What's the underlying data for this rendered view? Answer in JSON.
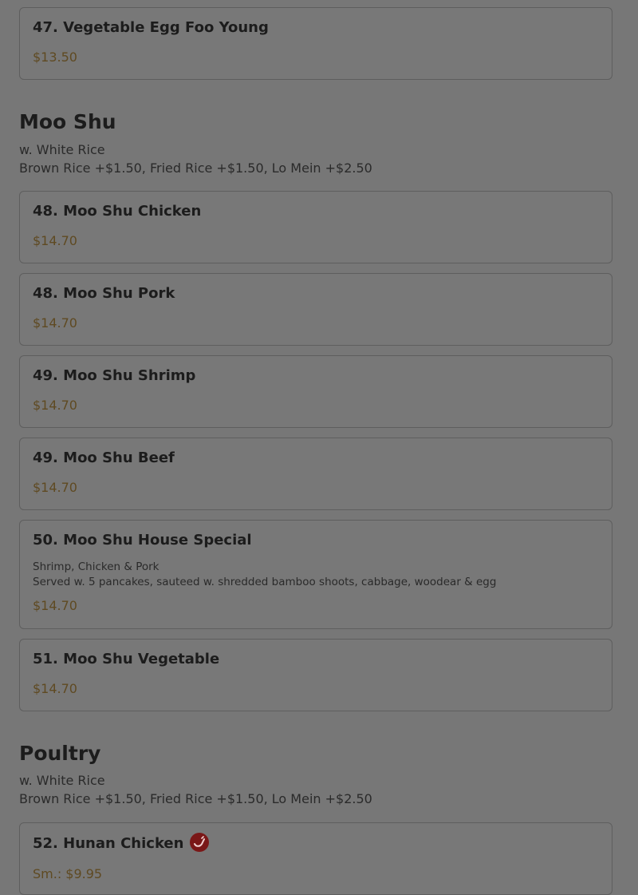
{
  "items": [
    {
      "title": "47. Vegetable Egg Foo Young",
      "price": "$13.50"
    },
    {
      "title": "48. Moo Shu Chicken",
      "price": "$14.70"
    },
    {
      "title": "48. Moo Shu Pork",
      "price": "$14.70"
    },
    {
      "title": "49. Moo Shu Shrimp",
      "price": "$14.70"
    },
    {
      "title": "49. Moo Shu Beef",
      "price": "$14.70"
    },
    {
      "title": "50. Moo Shu House Special",
      "desc1": "Shrimp, Chicken & Pork",
      "desc2": "Served w. 5 pancakes, sauteed w. shredded bamboo shoots, cabbage, woodear & egg",
      "price": "$14.70"
    },
    {
      "title": "51. Moo Shu Vegetable",
      "price": "$14.70"
    },
    {
      "title": "52. Hunan Chicken",
      "price": "Sm.: $9.95",
      "icon": "chili-pepper-icon"
    }
  ],
  "sections": [
    {
      "title": "Moo Shu",
      "note1": "w. White Rice",
      "note2": "Brown Rice +$1.50, Fried Rice +$1.50, Lo Mein +$2.50"
    },
    {
      "title": "Poultry",
      "note1": "w. White Rice",
      "note2": "Brown Rice +$1.50, Fried Rice +$1.50, Lo Mein +$2.50"
    }
  ],
  "colors": {
    "overlay_bg": "#777777",
    "price": "#5f4a22",
    "spicy_badge": "#7a1717"
  }
}
